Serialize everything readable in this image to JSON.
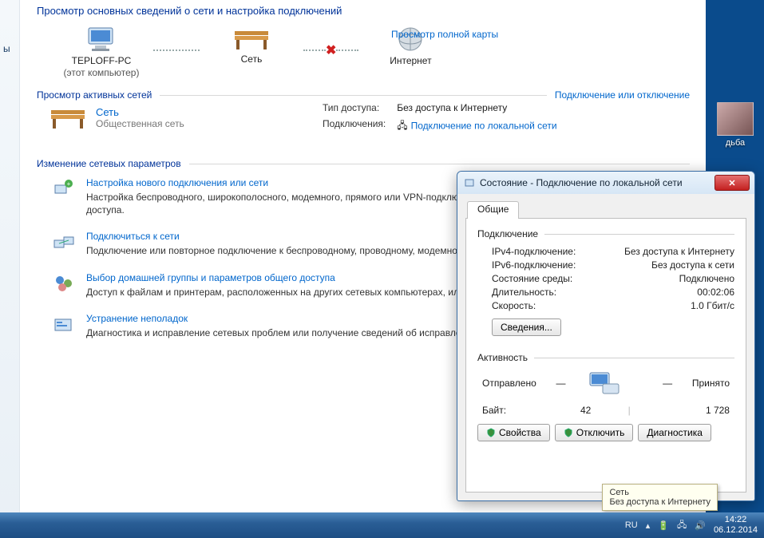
{
  "page": {
    "title": "Просмотр основных сведений о сети и настройка подключений",
    "full_map_link": "Просмотр полной карты",
    "section_active_hd": "Просмотр активных сетей",
    "connect_disconnect_link": "Подключение или отключение",
    "section_change_hd": "Изменение сетевых параметров",
    "sidebar_fragment": "ы"
  },
  "netmap": {
    "node1": "TEPLOFF-PC",
    "node1_sub": "(этот компьютер)",
    "node2": "Сеть",
    "node3": "Интернет"
  },
  "active_net": {
    "name": "Сеть",
    "type": "Общественная сеть",
    "access_label": "Тип доступа:",
    "access_value": "Без доступа к Интернету",
    "conn_label": "Подключения:",
    "conn_value": "Подключение по локальной сети"
  },
  "settings": [
    {
      "title": "Настройка нового подключения или сети",
      "desc": "Настройка беспроводного, широкополосного, модемного, прямого или VPN-подключения или же настройка маршрутизатора или точки доступа."
    },
    {
      "title": "Подключиться к сети",
      "desc": "Подключение или повторное подключение к беспроводному, проводному, модемному сетевому соединению или подключение к VPN."
    },
    {
      "title": "Выбор домашней группы и параметров общего доступа",
      "desc": "Доступ к файлам и принтерам, расположенных на других сетевых компьютерах, или изменение параметров общего доступа."
    },
    {
      "title": "Устранение неполадок",
      "desc": "Диагностика и исправление сетевых проблем или получение сведений об исправлении."
    }
  ],
  "dlg": {
    "title": "Состояние - Подключение по локальной сети",
    "tab_general": "Общие",
    "grp_conn": "Подключение",
    "ipv4_l": "IPv4-подключение:",
    "ipv4_v": "Без доступа к Интернету",
    "ipv6_l": "IPv6-подключение:",
    "ipv6_v": "Без доступа к сети",
    "media_l": "Состояние среды:",
    "media_v": "Подключено",
    "dur_l": "Длительность:",
    "dur_v": "00:02:06",
    "speed_l": "Скорость:",
    "speed_v": "1.0 Гбит/с",
    "details_btn": "Сведения...",
    "grp_act": "Активность",
    "sent_l": "Отправлено",
    "dash": "—",
    "recv_l": "Принято",
    "bytes_l": "Байт:",
    "sent_v": "42",
    "recv_v": "1 728",
    "btn_props": "Свойства",
    "btn_disable": "Отключить",
    "btn_diag": "Диагностика"
  },
  "balloon": {
    "t": "Сеть",
    "s": "Без доступа к Интернету"
  },
  "tray": {
    "lang": "RU",
    "time": "14:22",
    "date": "06.12.2014"
  },
  "desktop": {
    "icon_label": "дьба"
  }
}
